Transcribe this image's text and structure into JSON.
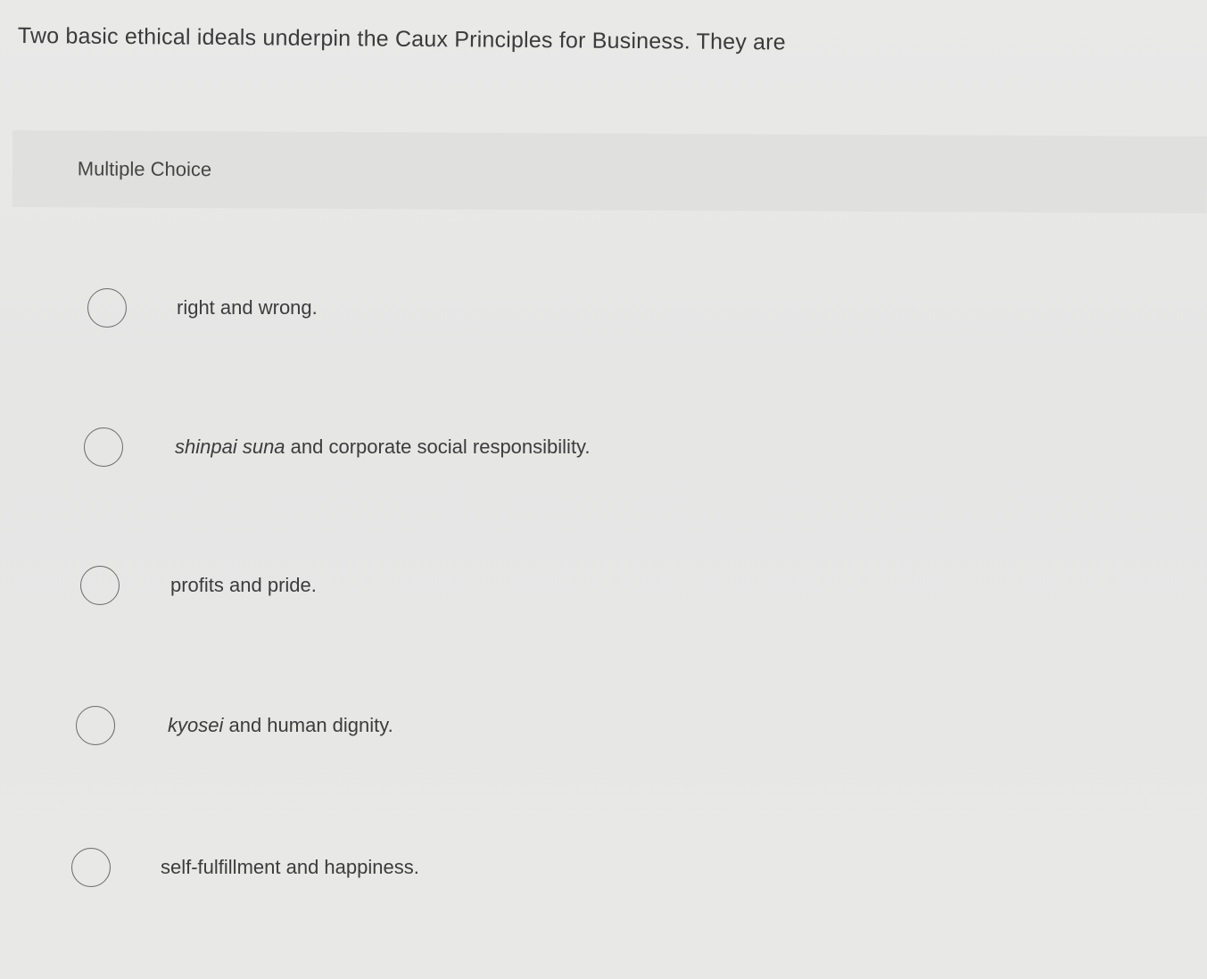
{
  "question": {
    "text": "Two basic ethical ideals underpin the Caux Principles for Business. They are"
  },
  "question_type": "Multiple Choice",
  "options": [
    {
      "italic": "",
      "text": "right and wrong."
    },
    {
      "italic": "shinpai suna",
      "text": " and corporate social responsibility."
    },
    {
      "italic": "",
      "text": "profits and pride."
    },
    {
      "italic": "kyosei",
      "text": " and human dignity."
    },
    {
      "italic": "",
      "text": "self-fulfillment and happiness."
    }
  ]
}
